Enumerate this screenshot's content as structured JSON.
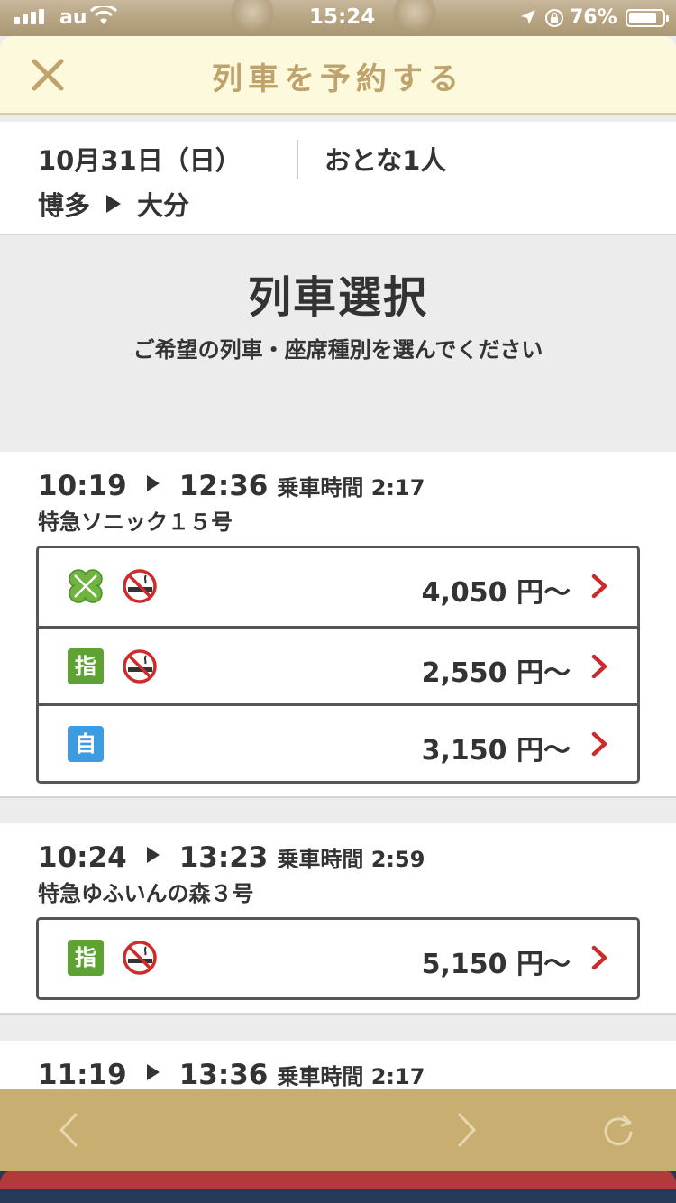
{
  "status": {
    "carrier": "au",
    "time": "15:24",
    "battery": "76%",
    "battery_level": 0.76
  },
  "header": {
    "title": "列車を予約する"
  },
  "summary": {
    "date": "10月31日（日）",
    "passengers": "おとな1人",
    "from": "博多",
    "to": "大分"
  },
  "selection": {
    "title": "列車選択",
    "subtitle": "ご希望の列車・座席種別を選んでください"
  },
  "trains": [
    {
      "depart": "10:19",
      "arrive": "12:36",
      "duration": "乗車時間 2:17",
      "name": "特急ソニック１５号",
      "seats": [
        {
          "type": "green-car-icon",
          "badge": "",
          "non_smoking": true,
          "price": "4,050 円〜"
        },
        {
          "type": "reserved-seat-icon",
          "badge": "指",
          "non_smoking": true,
          "price": "2,550 円〜"
        },
        {
          "type": "unreserved-seat-icon",
          "badge": "自",
          "non_smoking": false,
          "price": "3,150 円〜"
        }
      ]
    },
    {
      "depart": "10:24",
      "arrive": "13:23",
      "duration": "乗車時間 2:59",
      "name": "特急ゆふいんの森３号",
      "seats": [
        {
          "type": "reserved-seat-icon",
          "badge": "指",
          "non_smoking": true,
          "price": "5,150 円〜"
        }
      ]
    },
    {
      "depart": "11:19",
      "arrive": "13:36",
      "duration": "乗車時間 2:17"
    }
  ],
  "colors": {
    "header_bg": "#fdf9dd",
    "header_text": "#bfa36a",
    "toolbar": "#c8ae71",
    "chevron": "#cc2b2b",
    "green_badge": "#5ea234",
    "blue_badge": "#3d9be2"
  }
}
